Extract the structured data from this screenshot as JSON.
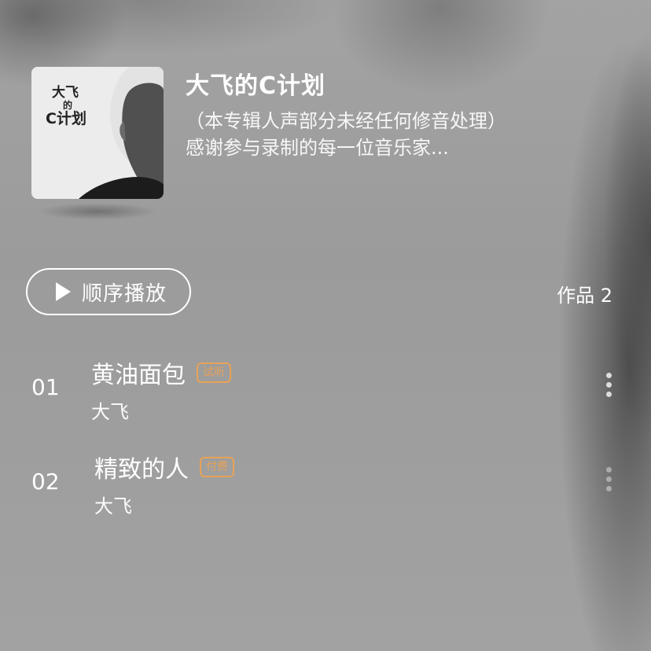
{
  "album": {
    "title": "大飞的C计划",
    "description_line1": "（本专辑人声部分未经任何修音处理）",
    "description_line2": "感谢参与录制的每一位音乐家...",
    "cover_text_line1": "大飞",
    "cover_text_line2": "的",
    "cover_text_line3": "C计划",
    "cover_icon": "album-cover-image"
  },
  "controls": {
    "play_label": "顺序播放",
    "play_icon": "play-icon",
    "works_label": "作品 2"
  },
  "tracks": [
    {
      "number": "01",
      "title": "黄油面包",
      "badge": "试听",
      "artist": "大飞"
    },
    {
      "number": "02",
      "title": "精致的人",
      "badge": "付费",
      "artist": "大飞"
    }
  ],
  "colors": {
    "badge": "#e8a257",
    "text": "#ffffff",
    "background": "#9d9d9d"
  }
}
